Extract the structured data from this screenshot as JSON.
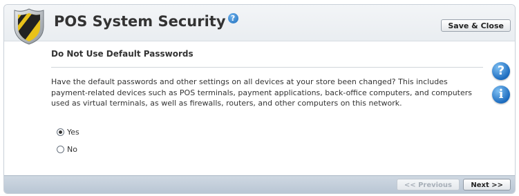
{
  "header": {
    "title": "POS System Security",
    "help_icon": "?",
    "save_close_label": "Save & Close",
    "shield_icon": "shield-icon"
  },
  "section": {
    "title": "Do Not Use Default Passwords",
    "question": "Have the default passwords and other settings on all devices at your store been changed?  This includes payment-related devices such as POS terminals, payment applications, back-office computers, and computers used as virtual terminals, as well as firewalls, routers, and other computers on this network."
  },
  "side_icons": {
    "help": "?",
    "info": "i"
  },
  "options": [
    {
      "label": "Yes",
      "selected": true
    },
    {
      "label": "No",
      "selected": false
    }
  ],
  "footer": {
    "previous_label": "<< Previous",
    "previous_enabled": false,
    "next_label": "Next >>"
  },
  "colors": {
    "accent_blue": "#1d6cbf",
    "shield_yellow": "#e8c21a",
    "footer_bar": "#c3cedb"
  }
}
